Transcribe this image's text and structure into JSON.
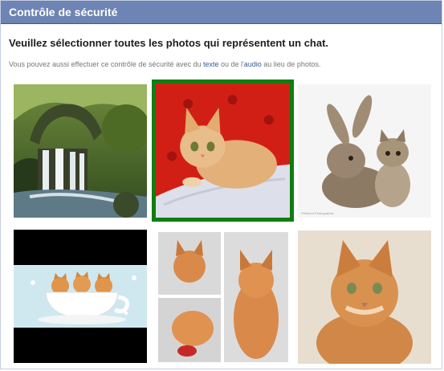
{
  "dialog": {
    "title": "Contrôle de sécurité",
    "heading": "Veuillez sélectionner toutes les photos qui représentent un chat.",
    "alt_prefix": "Vous pouvez aussi effectuer ce contrôle de sécurité avec du ",
    "text_link": "texte",
    "alt_middle": " ou de l'",
    "audio_link": "audio",
    "alt_suffix": " au lieu de photos."
  },
  "photos": [
    {
      "subject": "waterfall",
      "selected": false
    },
    {
      "subject": "cat",
      "selected": true
    },
    {
      "subject": "rabbit-and-kitten",
      "selected": false,
      "watermark": "©Warren Photographic"
    },
    {
      "subject": "kittens-in-teacup",
      "selected": false
    },
    {
      "subject": "cat-collage",
      "selected": false
    },
    {
      "subject": "cat",
      "selected": false
    }
  ],
  "colors": {
    "header_bg": "#6d84b4",
    "link": "#3b5998",
    "selected_border": "#0f7d0f"
  }
}
